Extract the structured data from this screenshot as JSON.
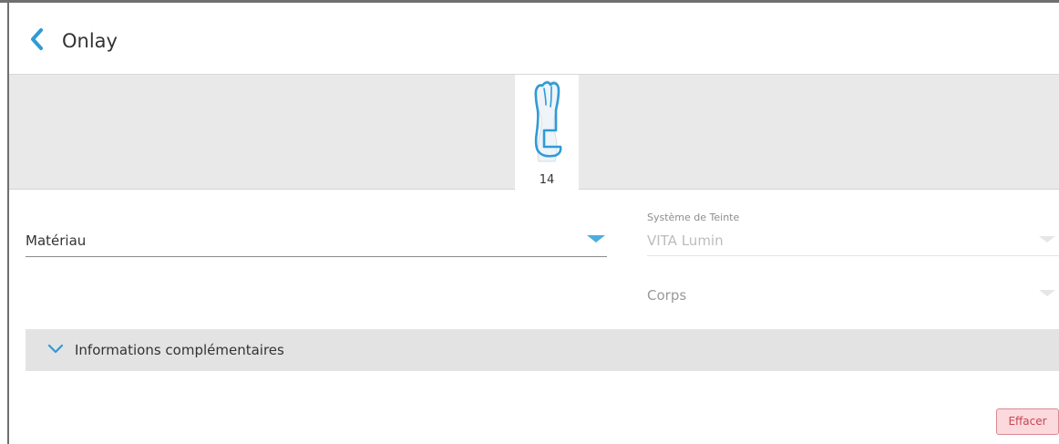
{
  "header": {
    "title": "Onlay",
    "back_icon": "chevron-left-icon"
  },
  "tooth": {
    "number": "14",
    "icon": "tooth-icon"
  },
  "form": {
    "material": {
      "value": "Matériau"
    },
    "shade_system": {
      "label": "Système de Teinte",
      "value": "VITA Lumin"
    },
    "body": {
      "value": "Corps"
    }
  },
  "more_info": {
    "label": "Informations complémentaires",
    "icon": "chevron-down-icon"
  },
  "actions": {
    "clear_label": "Effacer"
  },
  "colors": {
    "accent": "#4aaee0",
    "danger_text": "#c44753",
    "danger_bg": "#fbd9dd"
  }
}
